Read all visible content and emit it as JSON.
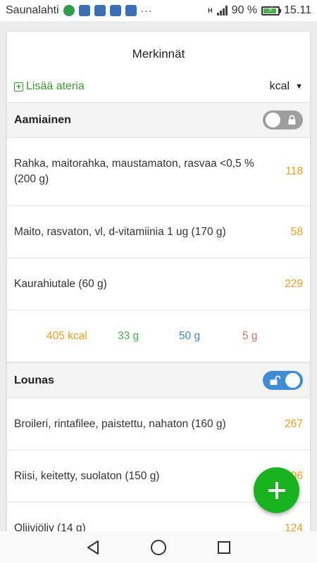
{
  "status_bar": {
    "carrier": "Saunalahti",
    "network": "H",
    "battery": "90 %",
    "battery_level": 0.9,
    "time": "15.11",
    "more": "···"
  },
  "title": "Merkinnät",
  "add_meal_label": "Lisää ateria",
  "unit": "kcal",
  "colors": {
    "accent_green": "#3b9b2f",
    "kcal": "#f0a020",
    "protein": "#4caf50",
    "carbs": "#3f8bd6",
    "fat": "#e86f6f",
    "fab": "#19b31f",
    "toggle_on": "#3f8bd6",
    "toggle_off": "#9e9e9e"
  },
  "meals": [
    {
      "name": "Aamiainen",
      "locked": true,
      "items": [
        {
          "name": "Rahka, maitorahka, maustamaton, rasvaa <0,5 % (200 g)",
          "kcal": "118"
        },
        {
          "name": "Maito, rasvaton, vl, d-vitamiinia 1 ug (170 g)",
          "kcal": "58"
        },
        {
          "name": "Kaurahiutale (60 g)",
          "kcal": "229"
        }
      ],
      "totals": {
        "kcal": "405 kcal",
        "protein": "33 g",
        "carbs": "50 g",
        "fat": "5 g"
      }
    },
    {
      "name": "Lounas",
      "locked": false,
      "items": [
        {
          "name": "Broileri, rintafilee, paistettu, nahaton (160 g)",
          "kcal": "267"
        },
        {
          "name": "Riisi, keitetty, suolaton (150 g)",
          "kcal": "206"
        },
        {
          "name": "Oliiviöljy (14 g)",
          "kcal": "124"
        }
      ]
    }
  ]
}
